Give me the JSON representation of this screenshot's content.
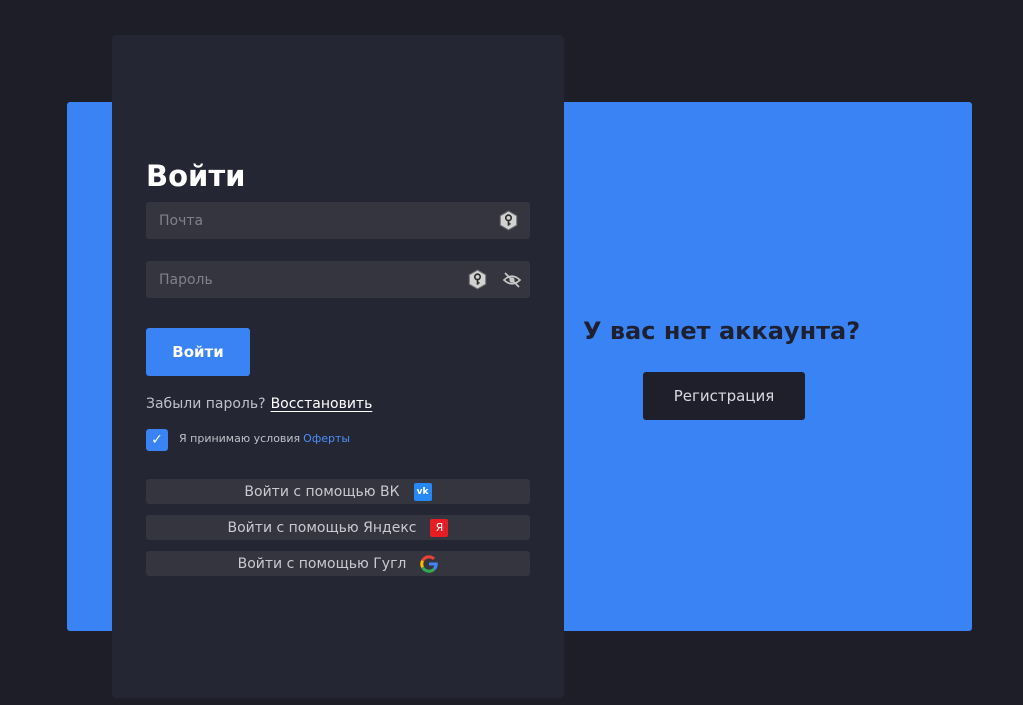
{
  "login": {
    "title": "Войти",
    "email": {
      "placeholder": "Почта",
      "value": ""
    },
    "password": {
      "placeholder": "Пароль",
      "value": ""
    },
    "submit_label": "Войти",
    "forgot_text": "Забыли пароль?",
    "restore_label": "Восстановить",
    "terms_checked": true,
    "terms_text": "Я принимаю условия",
    "terms_link": "Оферты",
    "checkmark": "✓",
    "social": [
      {
        "label": "Войти с помощью ВК",
        "icon": "vk-icon",
        "icon_text": "vk"
      },
      {
        "label": "Войти с помощью Яндекс",
        "icon": "yandex-icon",
        "icon_text": "Я"
      },
      {
        "label": "Войти с помощью Гугл",
        "icon": "google-icon"
      }
    ]
  },
  "signup": {
    "prompt": "У вас нет аккаунта?",
    "register_label": "Регистрация"
  },
  "colors": {
    "background": "#1e1e29",
    "card": "#242634",
    "accent": "#3a83f5",
    "field": "#34353f"
  }
}
